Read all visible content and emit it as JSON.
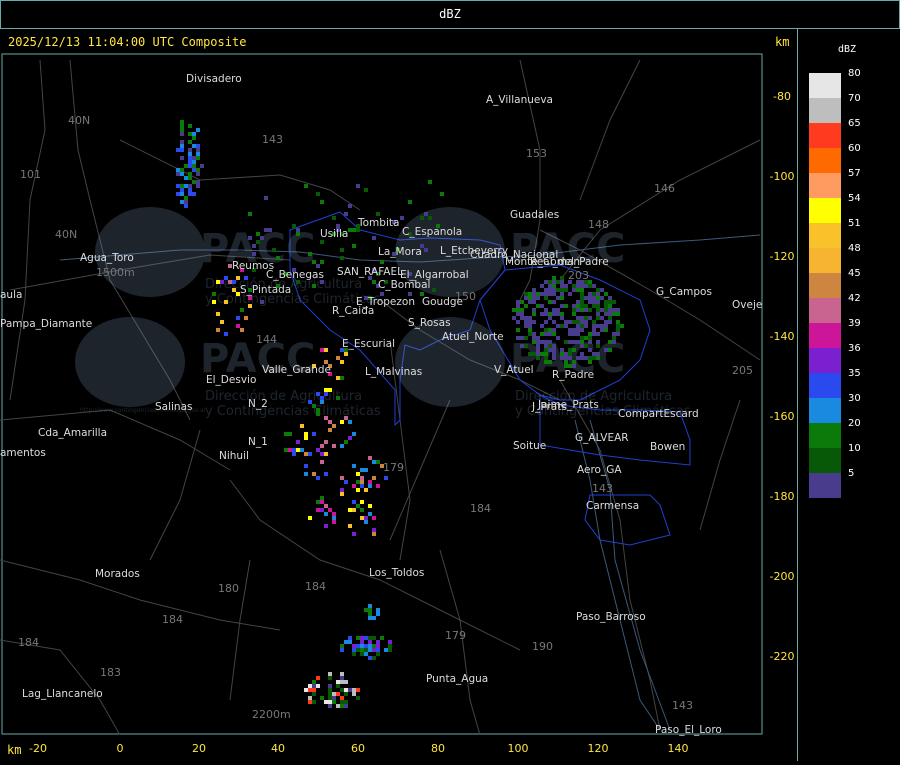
{
  "window_title": "dBZ",
  "header": {
    "timestamp_label": "2025/12/13 11:04:00 UTC Composite",
    "km_label_top": "km",
    "km_label_bottom": "km"
  },
  "legend": {
    "title": "dBZ",
    "entries": [
      {
        "label": "80",
        "color": "#e6e6e6"
      },
      {
        "label": "70",
        "color": "#bebebe"
      },
      {
        "label": "65",
        "color": "#ff3a1e"
      },
      {
        "label": "60",
        "color": "#ff6a00"
      },
      {
        "label": "57",
        "color": "#ff9a60"
      },
      {
        "label": "54",
        "color": "#ffff00"
      },
      {
        "label": "51",
        "color": "#f9c12a"
      },
      {
        "label": "48",
        "color": "#f7b431"
      },
      {
        "label": "45",
        "color": "#cd853f"
      },
      {
        "label": "42",
        "color": "#c9638f"
      },
      {
        "label": "39",
        "color": "#cc1599"
      },
      {
        "label": "36",
        "color": "#7a20d0"
      },
      {
        "label": "35",
        "color": "#2a4af0"
      },
      {
        "label": "30",
        "color": "#1a8ae0"
      },
      {
        "label": "20",
        "color": "#0b7a0b"
      },
      {
        "label": "10",
        "color": "#075807"
      },
      {
        "label": "5",
        "color": "#4a3c8c"
      }
    ]
  },
  "axes": {
    "x_ticks": [
      "-20",
      "0",
      "20",
      "40",
      "60",
      "80",
      "100",
      "120",
      "140"
    ],
    "y_ticks": [
      "-80",
      "-100",
      "-120",
      "-140",
      "-160",
      "-180",
      "-200",
      "-220"
    ]
  },
  "places": [
    {
      "name": "Divisadero"
    },
    {
      "name": "A_Villanueva"
    },
    {
      "name": "Guadales"
    },
    {
      "name": "Agua_Toro"
    },
    {
      "name": "Reumos"
    },
    {
      "name": "S_Pintada"
    },
    {
      "name": "C_Benegas"
    },
    {
      "name": "SAN_RAFAEL"
    },
    {
      "name": "C_Bombal"
    },
    {
      "name": "E_Tropezon"
    },
    {
      "name": "Goudge"
    },
    {
      "name": "R_Caida"
    },
    {
      "name": "S_Rosas"
    },
    {
      "name": "Atuel_Norte"
    },
    {
      "name": "E_Escurial"
    },
    {
      "name": "Valle_Grande"
    },
    {
      "name": "L_Malvinas"
    },
    {
      "name": "V_Atuel"
    },
    {
      "name": "R_Padre"
    },
    {
      "name": "El_Desvio"
    },
    {
      "name": "Salinas"
    },
    {
      "name": "N_2"
    },
    {
      "name": "N_1"
    },
    {
      "name": "Nihuil"
    },
    {
      "name": "Cda_Amarilla"
    },
    {
      "name": "amentos"
    },
    {
      "name": "J_Prats"
    },
    {
      "name": "CompartEscard"
    },
    {
      "name": "G_ALVEAR"
    },
    {
      "name": "Soitue"
    },
    {
      "name": "Bowen"
    },
    {
      "name": "Aero_GA"
    },
    {
      "name": "Carmensa"
    },
    {
      "name": "Morados"
    },
    {
      "name": "Los_Toldos"
    },
    {
      "name": "Paso_Barroso"
    },
    {
      "name": "Punta_Agua"
    },
    {
      "name": "Lag_Llancanelo"
    },
    {
      "name": "Paso_El_Loro"
    },
    {
      "name": "G_Campos"
    },
    {
      "name": "Oveje"
    },
    {
      "name": "Usilla"
    },
    {
      "name": "Tombita"
    },
    {
      "name": "C_Espanola"
    },
    {
      "name": "La_Mora"
    },
    {
      "name": "L_Etcheverry"
    },
    {
      "name": "Real_del_Padre"
    },
    {
      "name": "Pampa_Diamante"
    },
    {
      "name": "aula"
    },
    {
      "name": "El_Algarrobal"
    },
    {
      "name": "Cuadro_Nacional"
    },
    {
      "name": "Monte_Coman"
    },
    {
      "name": "Jaime_Prats"
    }
  ],
  "road_numbers": [
    "40N",
    "101",
    "40N",
    "143",
    "153",
    "146",
    "148",
    "203",
    "144",
    "179",
    "184",
    "184",
    "180",
    "184",
    "183",
    "179",
    "190",
    "143",
    "143",
    "205",
    "184",
    "1500m",
    "2200m",
    "150"
  ],
  "watermark": {
    "logo": "PACC",
    "line1": "Dirección de Agricultura",
    "line2": "y Contingencias Climáticas",
    "url": "http://www.contingencias.mendoza.gov.ar"
  }
}
